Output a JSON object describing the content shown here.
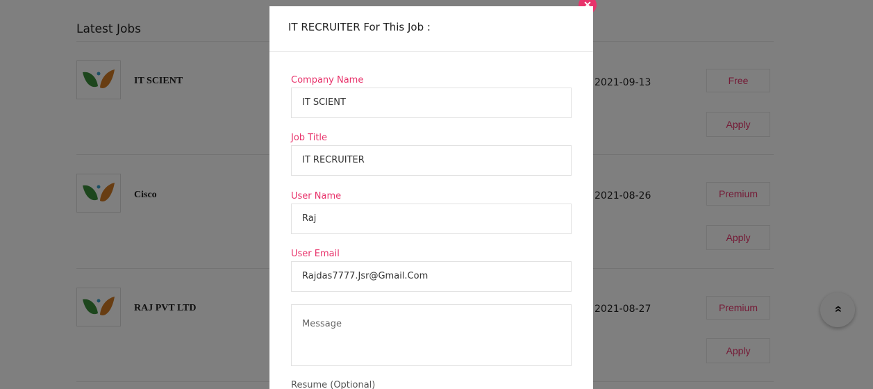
{
  "section": {
    "title": "Latest Jobs"
  },
  "jobs": [
    {
      "company": "IT SCIENT",
      "date": "2021-09-13",
      "badge": "Free",
      "apply": "Apply"
    },
    {
      "company": "Cisco",
      "date": "2021-08-26",
      "badge": "Premium",
      "apply": "Apply"
    },
    {
      "company": "RAJ PVT LTD",
      "date": "2021-08-27",
      "badge": "Premium",
      "apply": "Apply"
    }
  ],
  "scroll_top": {
    "icon": "double-chevron-up-icon",
    "glyph": "»"
  },
  "modal": {
    "title": "IT RECRUITER For This Job :",
    "close_icon": "close-icon",
    "close_glyph": "✕",
    "fields": {
      "company_name": {
        "label": "Company Name",
        "value": "IT SCIENT"
      },
      "job_title": {
        "label": "Job Title",
        "value": "IT RECRUITER"
      },
      "user_name": {
        "label": "User Name",
        "value": "Raj"
      },
      "user_email": {
        "label": "User Email",
        "value": "Rajdas7777.Jsr@Gmail.Com"
      },
      "message": {
        "placeholder": "Message"
      },
      "resume": {
        "label": "Resume (Optional)"
      }
    }
  },
  "colors": {
    "accent": "#e8336b",
    "overlay": "rgba(0,0,0,0.5)"
  }
}
